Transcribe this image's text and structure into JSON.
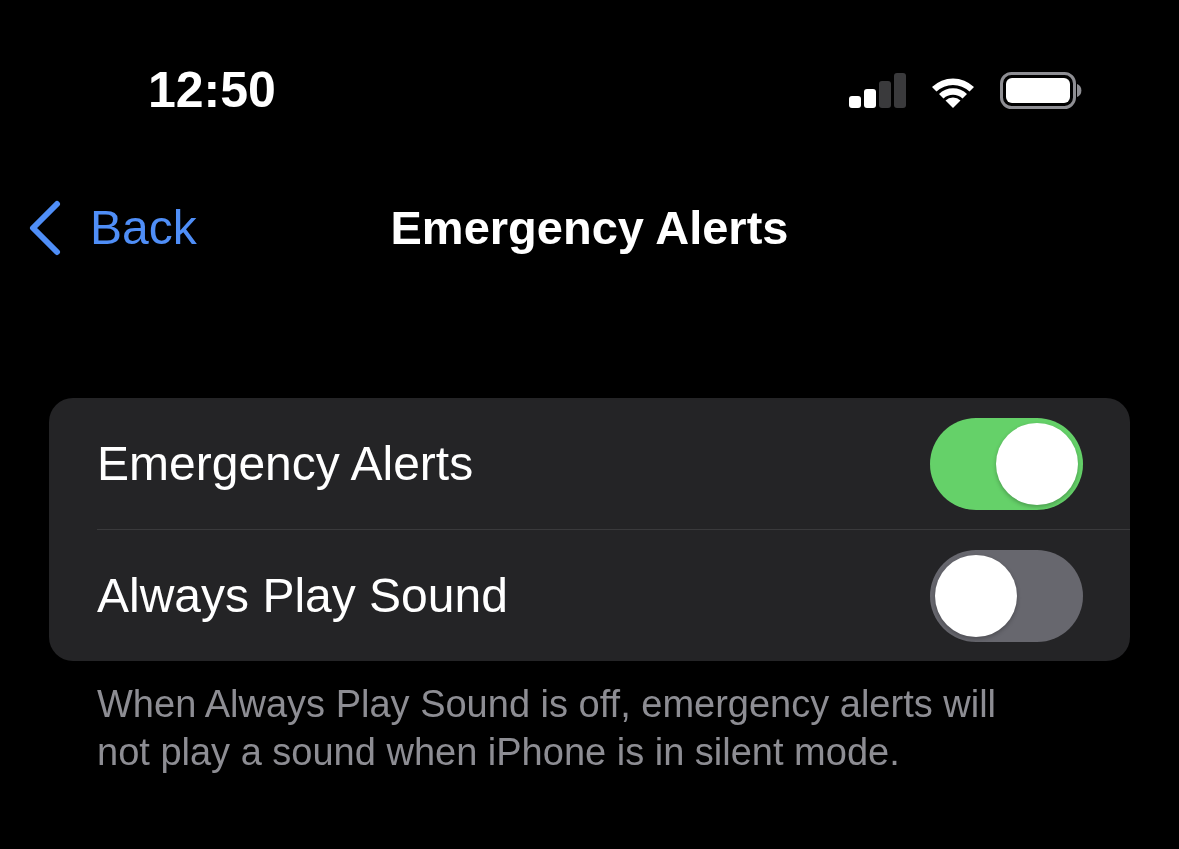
{
  "status_bar": {
    "time": "12:50"
  },
  "nav": {
    "back": "Back",
    "title": "Emergency Alerts"
  },
  "settings": [
    {
      "label": "Emergency Alerts",
      "on": true
    },
    {
      "label": "Always Play Sound",
      "on": false
    }
  ],
  "footer": "When Always Play Sound is off, emergency alerts will not play a sound when iPhone is in silent mode."
}
